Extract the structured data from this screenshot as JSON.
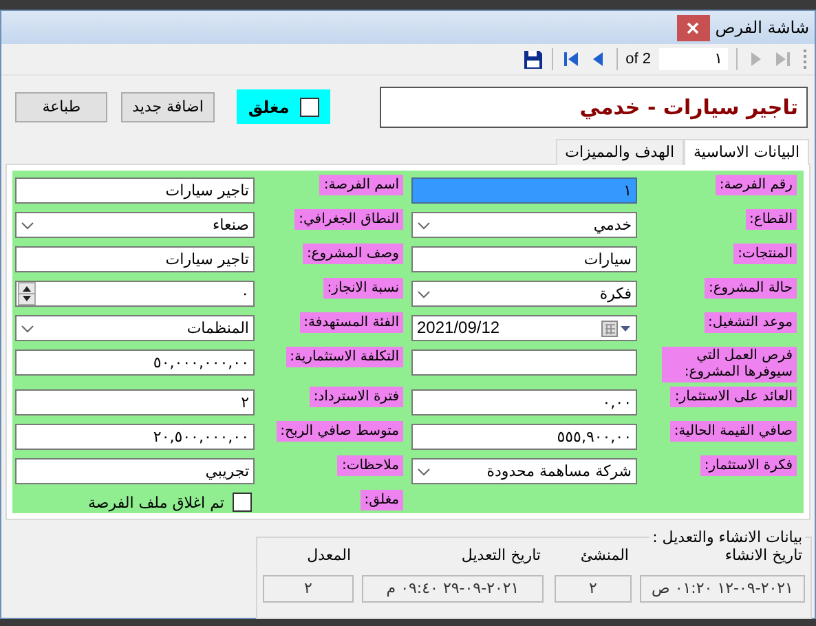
{
  "window": {
    "title": "شاشة الفرص"
  },
  "navigator": {
    "items": [
      {
        "kind": "last",
        "disabled": true
      },
      {
        "kind": "next",
        "disabled": true
      },
      {
        "kind": "position",
        "value": "١"
      },
      {
        "kind": "count",
        "text": "of 2"
      },
      {
        "kind": "prev",
        "disabled": false
      },
      {
        "kind": "first",
        "disabled": false
      },
      {
        "kind": "save",
        "disabled": false
      }
    ]
  },
  "header": {
    "title": "تاجير سيارات - خدمي",
    "closed": {
      "label": "مغلق",
      "checked": false
    },
    "buttons": [
      "اضافة جديد",
      "طباعة"
    ]
  },
  "tabs": [
    {
      "label": "البيانات الاساسية",
      "selected": true
    },
    {
      "label": "الهدف والمميزات",
      "selected": false
    }
  ],
  "form": {
    "right": [
      {
        "label": "رقم الفرصة:",
        "kind": "text",
        "value": "١",
        "highlighted": true
      },
      {
        "label": "القطاع:",
        "kind": "dropdown",
        "value": "خدمي"
      },
      {
        "label": "المنتجات:",
        "kind": "text",
        "value": "سيارات",
        "highlighted": false
      },
      {
        "label": "حالة المشروع:",
        "kind": "dropdown",
        "value": "فكرة"
      },
      {
        "label": "موعد التشغيل:",
        "kind": "date",
        "value": "2021/09/12"
      },
      {
        "label": "فرص العمل التي سيوفرها المشروع:",
        "kind": "text",
        "highlighted": false
      },
      {
        "label": "العائد على الاستثمار:",
        "kind": "text",
        "value": "٠,٠٠",
        "highlighted": false
      },
      {
        "label": "صافي القيمة الحالية:",
        "kind": "text",
        "value": "٥٥٥,٩٠٠,٠٠",
        "highlighted": false
      },
      {
        "label": "فكرة الاستثمار:",
        "kind": "dropdown",
        "value": "شركة مساهمة محدودة"
      }
    ],
    "left": [
      {
        "label": "اسم الفرصة:",
        "kind": "text",
        "value": "تاجير سيارات",
        "highlighted": false
      },
      {
        "label": "النطاق الجغرافي:",
        "kind": "dropdown",
        "value": "صنعاء"
      },
      {
        "label": "وصف المشروع:",
        "kind": "text",
        "value": "تاجير سيارات",
        "highlighted": false
      },
      {
        "label": "نسبة الانجاز:",
        "kind": "spinner",
        "value": "٠"
      },
      {
        "label": "الفئة المستهدفة:",
        "kind": "dropdown",
        "value": "المنظمات"
      },
      {
        "label": "التكلفة الاستثمارية:",
        "kind": "text",
        "value": "٥٠,٠٠٠,٠٠٠,٠٠",
        "highlighted": false
      },
      {
        "label": "فترة الاسترداد:",
        "kind": "text",
        "value": "٢",
        "highlighted": false
      },
      {
        "label": "متوسط صافي الربح:",
        "kind": "text",
        "value": "٢٠,٥٠٠,٠٠٠,٠٠",
        "highlighted": false
      },
      {
        "label": "ملاحظات:",
        "kind": "text",
        "value": "تجريبي",
        "highlighted": false
      },
      {
        "label": "مغلق:",
        "kind": "checkbox",
        "text": "تم اغلاق ملف الفرصة",
        "checked": false
      }
    ]
  },
  "audit": {
    "title": "بيانات الانشاء والتعديل :",
    "columns": [
      {
        "heading": "تاريخ الانشاء",
        "value": "٢٠٢١-٠٩-١٢ ٠١:٢٠ ص"
      },
      {
        "heading": "المنشئ",
        "value": "٢"
      },
      {
        "heading": "تاريخ التعديل",
        "value": "٢٠٢١-٠٩-٢٩ ٠٩:٤٠ م"
      },
      {
        "heading": "المعدل",
        "value": "٢"
      }
    ]
  }
}
